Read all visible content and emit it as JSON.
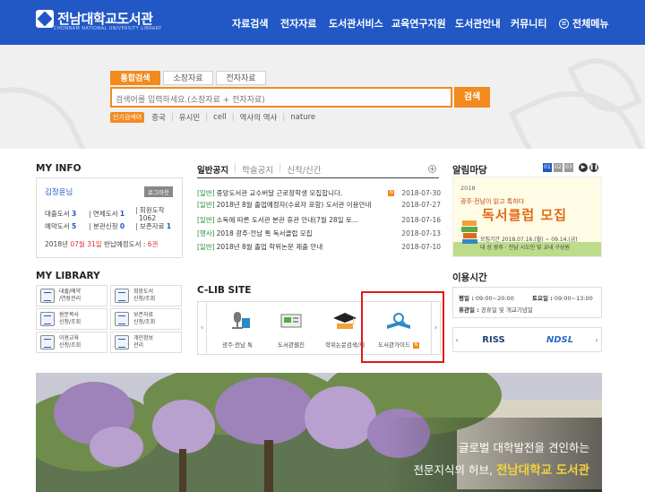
{
  "header": {
    "logo_text": "전남대학교도서관",
    "logo_sub": "CHONNAM NATIONAL UNIVERSITY LIBRARY",
    "nav": [
      "자료검색",
      "전자자료",
      "도서관서비스",
      "교육연구지원",
      "도서관안내",
      "커뮤니티"
    ],
    "all_menu": "전체메뉴",
    "bg_color": "#2158c6"
  },
  "search": {
    "tabs": [
      "통합검색",
      "소장자료",
      "전자자료"
    ],
    "placeholder": "검색어를 입력하세요.(소장자료 + 전자자료)",
    "button": "검색",
    "popular_label": "인기검색어",
    "popular": [
      "중국",
      "유시민",
      "cell",
      "역사의 역사",
      "nature"
    ],
    "accent": "#f28a1e"
  },
  "myinfo": {
    "heading": "MY INFO",
    "user": "김정윤님",
    "logout": "로그아웃",
    "loan_label": "대출도서",
    "loan_value": "3",
    "overdue_label": "연체도서",
    "overdue_value": "1",
    "fee_label": "회원도착",
    "fee_value": "1062",
    "reserve_label": "예약도서",
    "reserve_value": "5",
    "apply_label": "분관신청",
    "apply_value": "0",
    "keep_label": "보존자료",
    "keep_value": "1",
    "due_prefix": "2018년",
    "due_month": "07월",
    "due_day": "31일",
    "due_suffix": "반납예정도서 :",
    "due_count": "6권"
  },
  "notice": {
    "tabs": [
      "일반공지",
      "학술공지",
      "신착/신간"
    ],
    "plus": "+",
    "items": [
      {
        "cat": "[일반]",
        "title": "중앙도서관 교수버달 근로장학생 모집합니다.",
        "new": true,
        "date": "2018-07-30"
      },
      {
        "cat": "[일반]",
        "title": "2018년 8월 졸업예정자(수료자 포함) 도서관 이용안내",
        "new": false,
        "date": "2018-07-27"
      },
      {
        "cat": "[일반]",
        "title": "소독에 따른 도서관 본관 휴관 안내(7월 28일 토...",
        "new": false,
        "date": "2018-07-16"
      },
      {
        "cat": "[행사]",
        "title": "2018 광주·전남 톡 독서클럽 모집",
        "new": false,
        "date": "2018-07-13"
      },
      {
        "cat": "[일반]",
        "title": "2018년 8월 졸업 학위논문 제출 안내",
        "new": false,
        "date": "2018-07-10"
      }
    ]
  },
  "event": {
    "heading": "알림마당",
    "pages": [
      "01",
      "02",
      "03"
    ],
    "cap": "2018",
    "sub": "광주·전남이 읽고 톡하다",
    "title": "독서클럽 모집",
    "row1": "모집기간  2018.07.16.(월) ~ 09.14.(금)",
    "row2": "대      상  광주 · 전남 시도민 및 교내 구성원"
  },
  "mylibrary": {
    "heading": "MY LIBRARY",
    "items": [
      [
        "대출/예약",
        "/연장관리"
      ],
      [
        "희망도서",
        "신청/조회"
      ],
      [
        "원문복사",
        "신청/조회"
      ],
      [
        "보존자료",
        "신청/조회"
      ],
      [
        "이용교육",
        "신청/조회"
      ],
      [
        "개인정보",
        "관리"
      ]
    ]
  },
  "clib": {
    "heading": "C-LIB SITE",
    "items": [
      "광주·전남 톡",
      "도서관웹진",
      "학위논문검색/제",
      "도서관가이드"
    ]
  },
  "hours": {
    "heading": "이용시간",
    "weekday_label": "평일 :",
    "weekday": "09:00~20:00",
    "sat_label": "토요일 :",
    "sat": "09:00~13:00",
    "holiday_label": "휴관일 :",
    "holiday": "공휴일 및 개교기념일"
  },
  "links": [
    "RISS",
    "NDSL"
  ],
  "banner": {
    "line1": "글로벌 대학발전을 견인하는",
    "line2_prefix": "전문지식의 허브,",
    "line2_highlight": "전남대학교 도서관"
  }
}
